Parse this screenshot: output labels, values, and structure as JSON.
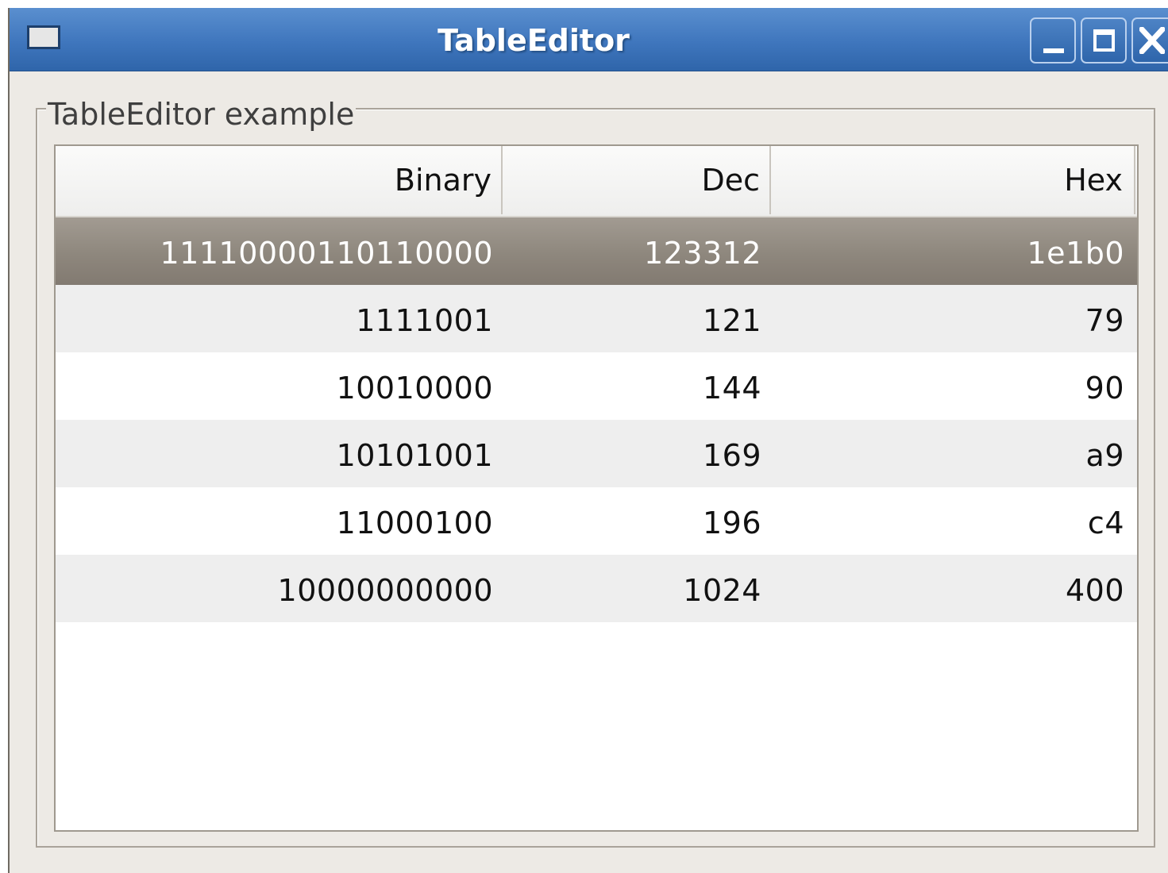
{
  "window": {
    "title": "TableEditor",
    "controls": {
      "minimize_icon": "minimize-icon",
      "maximize_icon": "maximize-icon",
      "close_icon": "close-icon"
    },
    "colors": {
      "titlebar": "#3f76bd",
      "body": "#edeae5",
      "selected_row": "#8e877d",
      "alternate_row": "#eeeeee"
    }
  },
  "group": {
    "title": "TableEditor example"
  },
  "table": {
    "columns": [
      "Binary",
      "Dec",
      "Hex"
    ],
    "rows": [
      [
        "11110000110110000",
        "123312",
        "1e1b0"
      ],
      [
        "1111001",
        "121",
        "79"
      ],
      [
        "10010000",
        "144",
        "90"
      ],
      [
        "10101001",
        "169",
        "a9"
      ],
      [
        "11000100",
        "196",
        "c4"
      ],
      [
        "10000000000",
        "1024",
        "400"
      ]
    ],
    "selected_row_index": 0
  }
}
